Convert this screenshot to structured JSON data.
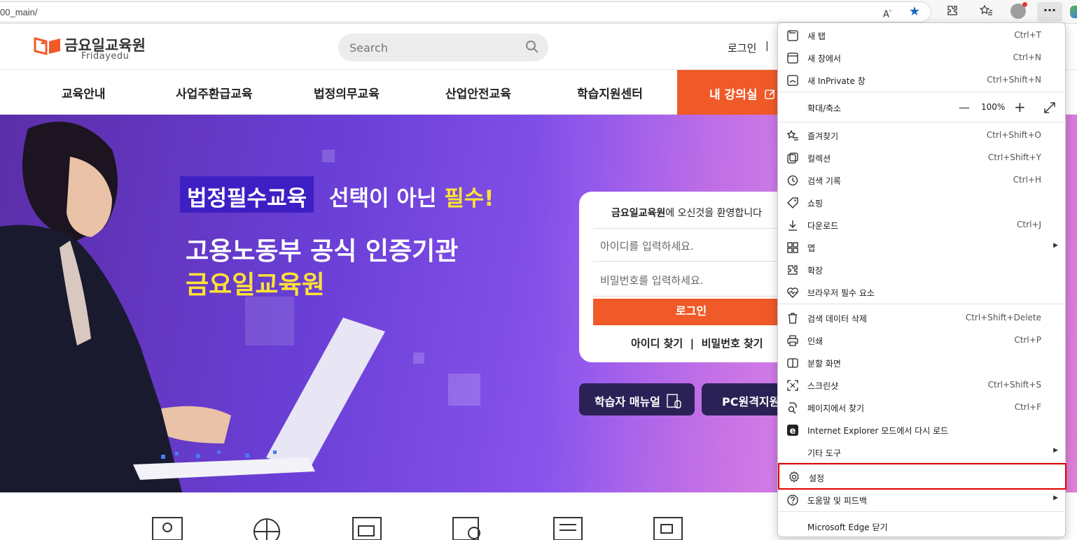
{
  "browser": {
    "url_text": "00_main/",
    "read_aloud_icon": "read-aloud-icon",
    "favorite_icon": "star-filled-icon"
  },
  "site": {
    "logo_name": "금요일교육원",
    "logo_sub": "Fridayedu",
    "search_placeholder": "Search",
    "login_link": "로그인",
    "login_sep": "|",
    "nav": [
      "교육안내",
      "사업주환급교육",
      "법정의무교육",
      "산업안전교육",
      "학습지원센터"
    ],
    "my_class": "내 강의실",
    "brand_color": "#f05a28"
  },
  "hero": {
    "tag_highlight": "법정필수교육",
    "tag_rest": "선택이 아닌",
    "tag_em": "필수!",
    "headline1": "고용노동부 공식 인증기관",
    "headline2": "금요일교육원",
    "login": {
      "welcome_bold": "금요일교육원",
      "welcome_rest": "에 오신것을 환영합니다",
      "id_placeholder": "아이디를 입력하세요.",
      "pw_placeholder": "비밀번호를 입력하세요.",
      "login_button": "로그인",
      "find_links": "아이디 찾기  |  비밀번호 찾기"
    },
    "manual_button": "학습자 매뉴얼",
    "remote_button": "PC원격지원"
  },
  "menu": {
    "items": [
      {
        "label": "새 탭",
        "shortcut": "Ctrl+T",
        "icon": "new-tab-icon"
      },
      {
        "label": "새 창에서",
        "shortcut": "Ctrl+N",
        "icon": "new-window-icon"
      },
      {
        "label": "새 InPrivate 창",
        "shortcut": "Ctrl+Shift+N",
        "icon": "inprivate-icon"
      },
      {
        "label": "확대/축소",
        "zoom": "100%",
        "zoom_minus": "—",
        "zoom_plus": "+"
      },
      {
        "label": "즐겨찾기",
        "shortcut": "Ctrl+Shift+O",
        "icon": "favorites-icon"
      },
      {
        "label": "컬렉션",
        "shortcut": "Ctrl+Shift+Y",
        "icon": "collections-icon"
      },
      {
        "label": "검색 기록",
        "shortcut": "Ctrl+H",
        "icon": "history-icon"
      },
      {
        "label": "쇼핑",
        "shortcut": "",
        "icon": "shopping-tag-icon"
      },
      {
        "label": "다운로드",
        "shortcut": "Ctrl+J",
        "icon": "download-icon"
      },
      {
        "label": "앱",
        "shortcut": "",
        "icon": "apps-icon"
      },
      {
        "label": "확장",
        "shortcut": "",
        "icon": "extensions-icon"
      },
      {
        "label": "브라우저 필수 요소",
        "shortcut": "",
        "icon": "heart-pulse-icon"
      },
      {
        "label": "검색 데이터 삭제",
        "shortcut": "Ctrl+Shift+Delete",
        "icon": "trash-icon"
      },
      {
        "label": "인쇄",
        "shortcut": "Ctrl+P",
        "icon": "print-icon"
      },
      {
        "label": "분할 화면",
        "shortcut": "",
        "icon": "split-screen-icon"
      },
      {
        "label": "스크린샷",
        "shortcut": "Ctrl+Shift+S",
        "icon": "screenshot-icon"
      },
      {
        "label": "페이지에서 찾기",
        "shortcut": "Ctrl+F",
        "icon": "find-icon"
      },
      {
        "label": "Internet Explorer 모드에서 다시 로드",
        "shortcut": "",
        "icon": "ie-mode-icon"
      },
      {
        "label": "기타 도구",
        "shortcut": ""
      },
      {
        "label": "설정",
        "shortcut": "",
        "icon": "settings-gear-icon"
      },
      {
        "label": "도움말 및 피드백",
        "shortcut": "",
        "icon": "help-icon"
      },
      {
        "label": "Microsoft Edge 닫기",
        "shortcut": ""
      }
    ],
    "highlight_color": "#e00000"
  }
}
